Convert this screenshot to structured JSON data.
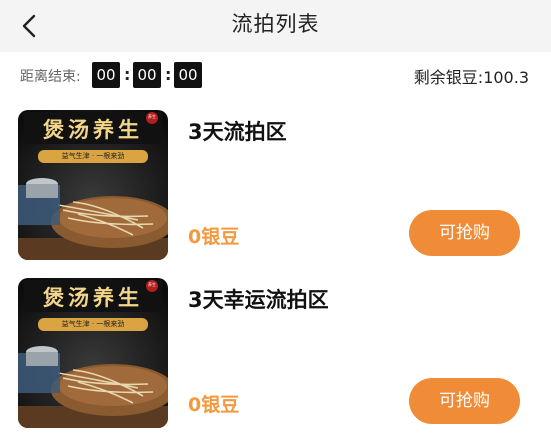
{
  "header": {
    "title": "流拍列表",
    "back_icon": "chevron-left-icon"
  },
  "countdown": {
    "label": "距离结束:",
    "hours": "00",
    "minutes": "00",
    "seconds": "00",
    "separator": ":"
  },
  "balance": {
    "label": "剩余银豆:",
    "value": "100.3"
  },
  "items": [
    {
      "title": "3天流拍区",
      "price": "0银豆",
      "button_label": "可抢购",
      "image": {
        "banner": "煲汤养生",
        "tagline": "益气生津 · 一根来劲",
        "seal": "养生"
      }
    },
    {
      "title": "3天幸运流拍区",
      "price": "0银豆",
      "button_label": "可抢购",
      "image": {
        "banner": "煲汤养生",
        "tagline": "益气生津 · 一根来劲",
        "seal": "养生"
      }
    }
  ],
  "colors": {
    "accent": "#f08c38",
    "price": "#f39a3f",
    "navbar_bg": "#f4f4f4",
    "timer_bg": "#111111"
  }
}
